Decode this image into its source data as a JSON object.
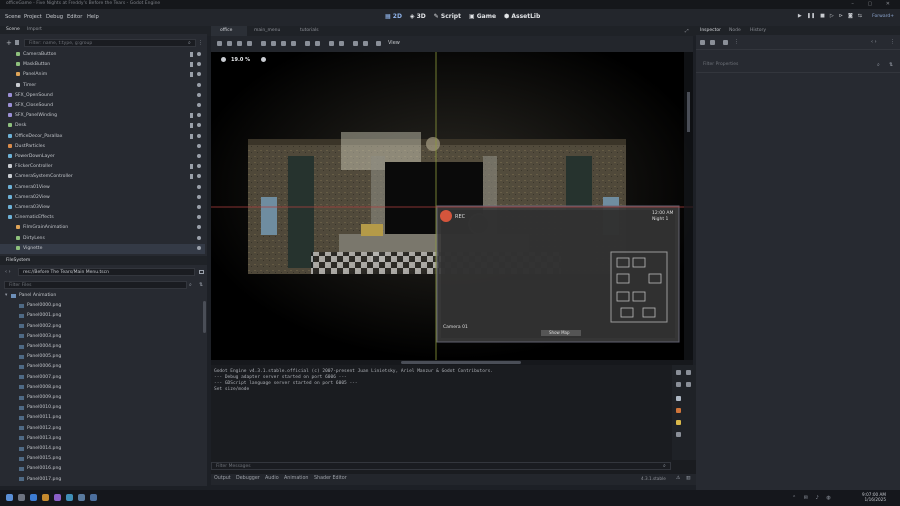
{
  "window": {
    "title": "officeGame - Five Nights at Freddy's Before the Tears - Godot Engine",
    "controls": "–  ▢  ✕"
  },
  "menubar": {
    "items": [
      "Scene",
      "Project",
      "Debug",
      "Editor",
      "Help"
    ],
    "modes": [
      "2D",
      "3D",
      "Script",
      "Game",
      "AssetLib"
    ],
    "renderer": "Forward+"
  },
  "scene_dock": {
    "tabs": [
      "Scene",
      "Import"
    ],
    "filter_placeholder": "Filter: name, t:type, g:group",
    "nodes": [
      {
        "label": "CameraButton"
      },
      {
        "label": "MaskButton"
      },
      {
        "label": "PanelAnim"
      },
      {
        "label": "Timer"
      },
      {
        "label": "SFX_OpenSound"
      },
      {
        "label": "SFX_CloseSound"
      },
      {
        "label": "SFX_PanelWinding"
      },
      {
        "label": "Desk"
      },
      {
        "label": "OfficeDecor_Parallax"
      },
      {
        "label": "DustParticles"
      },
      {
        "label": "PowerDownLayer"
      },
      {
        "label": "FlickerController"
      },
      {
        "label": "CameraSystemController"
      },
      {
        "label": "Camera01View"
      },
      {
        "label": "Camera02View"
      },
      {
        "label": "Camera03View"
      },
      {
        "label": "CinematicEffects"
      },
      {
        "label": "FilmGrainAnimation"
      },
      {
        "label": "DirtyLens"
      },
      {
        "label": "Vignette"
      }
    ]
  },
  "filesystem": {
    "tab": "FileSystem",
    "path": "res://Before The Tears/Main Menu.tscn",
    "filter_placeholder": "Filter Files",
    "folder": "Panel Animation",
    "files": [
      "Panel0000.png",
      "Panel0001.png",
      "Panel0002.png",
      "Panel0003.png",
      "Panel0004.png",
      "Panel0005.png",
      "Panel0006.png",
      "Panel0007.png",
      "Panel0008.png",
      "Panel0009.png",
      "Panel0010.png",
      "Panel0011.png",
      "Panel0012.png",
      "Panel0013.png",
      "Panel0014.png",
      "Panel0015.png",
      "Panel0016.png",
      "Panel0017.png"
    ]
  },
  "editor_tabs": [
    "office",
    "main_menu",
    "tutorials"
  ],
  "scene_toolbar": {
    "view_label": "View"
  },
  "viewport": {
    "zoom": "19.0 %",
    "cam_label": "REC",
    "cam_time": "12:00 AM",
    "cam_night": "Night 1",
    "cam_name": "Camera 01",
    "cam_footer": "Show Map"
  },
  "output": {
    "lines": [
      "Godot Engine v4.3.1.stable.official (c) 2007-present Juan Linietsky, Ariel Manzur & Godot Contributors.",
      "--- Debug adapter server started on port 6006 ---",
      "--- GDScript language server started on port 6005 ---",
      "Set size/mode"
    ],
    "filter_placeholder": "Filter Messages",
    "tabs": [
      "Output",
      "Debugger",
      "Audio",
      "Animation",
      "Shader Editor"
    ],
    "version": "4.3.1.stable"
  },
  "inspector": {
    "tabs": [
      "Inspector",
      "Node",
      "History"
    ],
    "filter_placeholder": "Filter Properties"
  },
  "taskbar": {
    "time": "9:07:00 AM",
    "date": "1/16/2025"
  }
}
